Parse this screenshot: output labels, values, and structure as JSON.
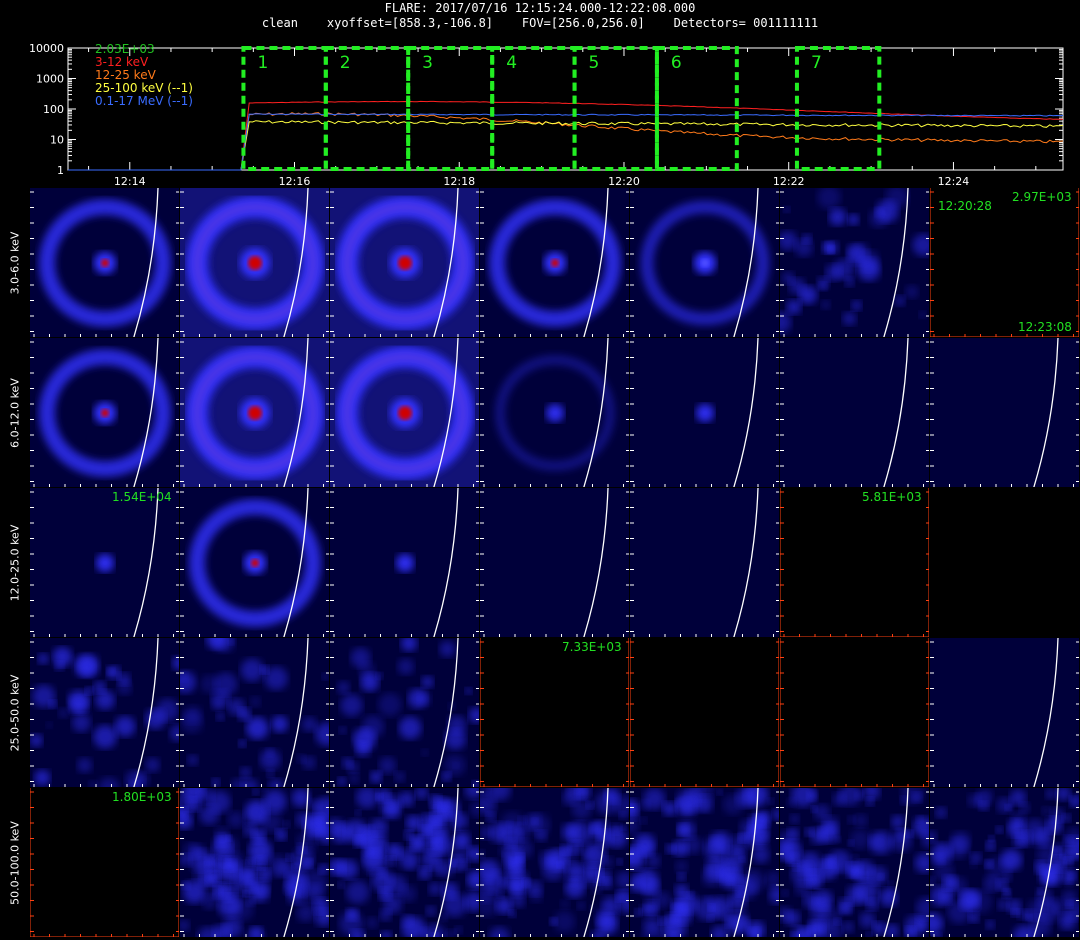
{
  "header": {
    "title": "FLARE: 2017/07/16 12:15:24.000-12:22:08.000",
    "params": "clean    xyoffset=[858.3,-106.8]    FOV=[256.0,256.0]    Detectors= 001111111"
  },
  "lightcurve": {
    "y_ticks": [
      "10000",
      "1000",
      "100",
      "10",
      "1"
    ],
    "x_ticks": [
      "12:14",
      "12:16",
      "12:18",
      "12:20",
      "12:22",
      "12:24"
    ],
    "legend": [
      {
        "label": "2.03E+03",
        "color": "#22c022"
      },
      {
        "label": "3-12 keV",
        "color": "#ff2020"
      },
      {
        "label": "12-25 keV",
        "color": "#ff7a1a"
      },
      {
        "label": "25-100 keV (--1)",
        "color": "#ffff40"
      },
      {
        "label": "0.1-17 MeV (--1)",
        "color": "#3a6cff"
      }
    ],
    "intervals": [
      "1",
      "2",
      "3",
      "4",
      "5",
      "6",
      "7"
    ],
    "colors": {
      "box": "#22ee22",
      "axis": "#ffffff"
    }
  },
  "grid": {
    "row_labels": [
      "3.0-6.0 keV",
      "6.0-12.0 keV",
      "12.0-25.0 keV",
      "25.0-50.0 keV",
      "50.0-100.0 keV"
    ],
    "annotations": {
      "r0c6_max": "2.97E+03",
      "r0c6_time_top": "12:20:28",
      "r0c6_time_bottom": "12:23:08",
      "r2c0_max": "1.54E+04",
      "r2c5_max": "5.81E+03",
      "r3c3_max": "7.33E+03",
      "r4c0_max": "1.80E+03"
    },
    "panel_types": [
      [
        "ring1",
        "ring2",
        "ring2",
        "ring1",
        "ring0",
        "noise",
        "empty_axes"
      ],
      [
        "ring1",
        "ring2",
        "ring2",
        "faint",
        "dot",
        "blank",
        "blank"
      ],
      [
        "dot",
        "ring1",
        "dot",
        "blank",
        "blank",
        "empty_axes",
        "empty"
      ],
      [
        "noise",
        "noise",
        "noise",
        "empty_axes",
        "empty_axes",
        "empty_axes",
        "blank"
      ],
      [
        "empty_axes",
        "noise",
        "noise",
        "noise",
        "noise",
        "noise",
        "noise"
      ]
    ],
    "colors": {
      "limb": "#ffffff",
      "empty_axis": "#ff4010",
      "ring": "#3030ff",
      "core": "#d00000"
    }
  }
}
